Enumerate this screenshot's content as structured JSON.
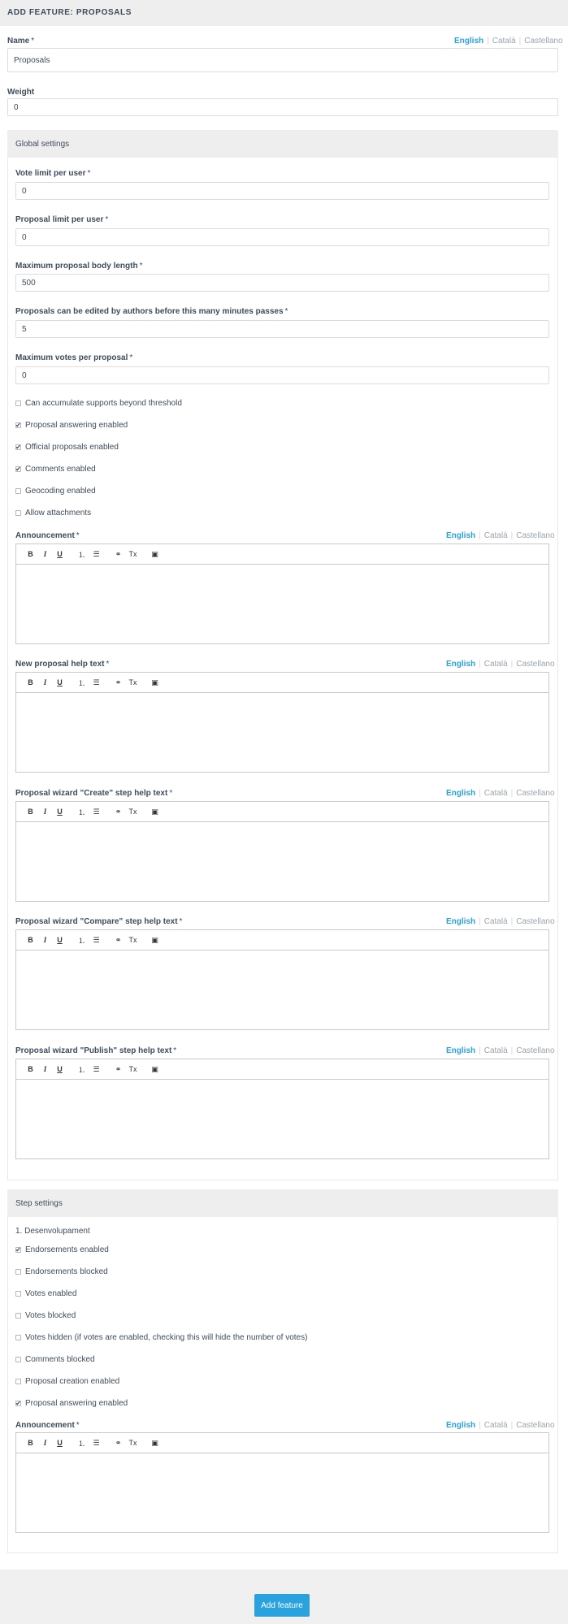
{
  "header": {
    "title": "ADD FEATURE: PROPOSALS"
  },
  "languages": [
    "English",
    "Català",
    "Castellano"
  ],
  "name": {
    "label": "Name",
    "required": "*",
    "value": "Proposals"
  },
  "weight": {
    "label": "Weight",
    "value": "0"
  },
  "global": {
    "title": "Global settings",
    "vote_limit": {
      "label": "Vote limit per user",
      "required": "*",
      "value": "0"
    },
    "proposal_limit": {
      "label": "Proposal limit per user",
      "required": "*",
      "value": "0"
    },
    "body_length": {
      "label": "Maximum proposal body length",
      "required": "*",
      "value": "500"
    },
    "edit_minutes": {
      "label": "Proposals can be edited by authors before this many minutes passes",
      "required": "*",
      "value": "5"
    },
    "max_votes": {
      "label": "Maximum votes per proposal",
      "required": "*",
      "value": "0"
    },
    "checkboxes": [
      {
        "label": "Can accumulate supports beyond threshold",
        "checked": false,
        "mark": ""
      },
      {
        "label": "Proposal answering enabled",
        "checked": true,
        "mark": "✔"
      },
      {
        "label": "Official proposals enabled",
        "checked": true,
        "mark": "✔"
      },
      {
        "label": "Comments enabled",
        "checked": true,
        "mark": "✔"
      },
      {
        "label": "Geocoding enabled",
        "checked": false,
        "mark": ""
      },
      {
        "label": "Allow attachments",
        "checked": false,
        "mark": ""
      }
    ],
    "editors": [
      {
        "label": "Announcement",
        "required": "*"
      },
      {
        "label": "New proposal help text",
        "required": "*"
      },
      {
        "label": "Proposal wizard \"Create\" step help text",
        "required": "*"
      },
      {
        "label": "Proposal wizard \"Compare\" step help text",
        "required": "*"
      },
      {
        "label": "Proposal wizard \"Publish\" step help text",
        "required": "*"
      }
    ]
  },
  "toolbar": {
    "bold": "B",
    "italic": "I",
    "underline": "U",
    "ordered_list": "⒈",
    "bullet_list": "☰",
    "link": "⚭",
    "clear": "Tx",
    "video": "▣"
  },
  "step": {
    "title": "Step settings",
    "step_name": "1. Desenvolupament",
    "checkboxes": [
      {
        "label": "Endorsements enabled",
        "checked": true,
        "mark": "✔"
      },
      {
        "label": "Endorsements blocked",
        "checked": false,
        "mark": ""
      },
      {
        "label": "Votes enabled",
        "checked": false,
        "mark": ""
      },
      {
        "label": "Votes blocked",
        "checked": false,
        "mark": ""
      },
      {
        "label": "Votes hidden (if votes are enabled, checking this will hide the number of votes)",
        "checked": false,
        "mark": ""
      },
      {
        "label": "Comments blocked",
        "checked": false,
        "mark": ""
      },
      {
        "label": "Proposal creation enabled",
        "checked": false,
        "mark": ""
      },
      {
        "label": "Proposal answering enabled",
        "checked": true,
        "mark": "✔"
      }
    ],
    "announcement": {
      "label": "Announcement",
      "required": "*"
    }
  },
  "submit": {
    "label": "Add feature"
  }
}
